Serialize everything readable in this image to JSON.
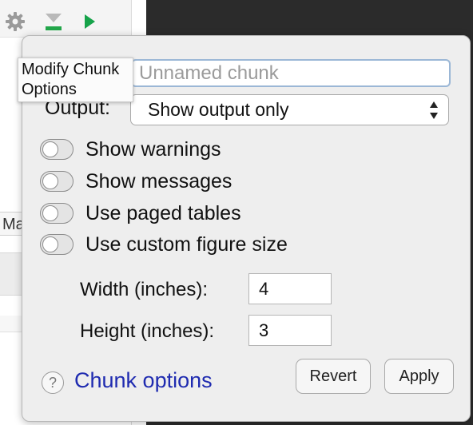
{
  "toolbar": {
    "icons": [
      "gear-icon",
      "run-previous-chunks-icon",
      "run-chunk-icon"
    ],
    "colors": {
      "gear": "#9a9a9a",
      "run_previous": "#22a64a",
      "run": "#16a34a"
    }
  },
  "tooltip": {
    "text_line1": "Modify Chunk",
    "text_line2": "Options"
  },
  "background": {
    "tab_label": "Ma",
    "dark_pane_color": "#2b2b2b"
  },
  "popover": {
    "chunk_name": {
      "value": "",
      "placeholder": "Unnamed chunk"
    },
    "output": {
      "label": "Output:",
      "selected": "Show output only"
    },
    "options": [
      {
        "label": "Show warnings",
        "checked": false
      },
      {
        "label": "Show messages",
        "checked": false
      },
      {
        "label": "Use paged tables",
        "checked": false
      },
      {
        "label": "Use custom figure size",
        "checked": false
      }
    ],
    "figure": {
      "width_label": "Width (inches):",
      "width_value": "4",
      "height_label": "Height (inches):",
      "height_value": "3"
    },
    "help": {
      "icon": "question-circle-icon",
      "symbol": "?",
      "link_text": "Chunk options",
      "link_color": "#1f2bb0"
    },
    "buttons": {
      "revert": "Revert",
      "apply": "Apply"
    }
  }
}
